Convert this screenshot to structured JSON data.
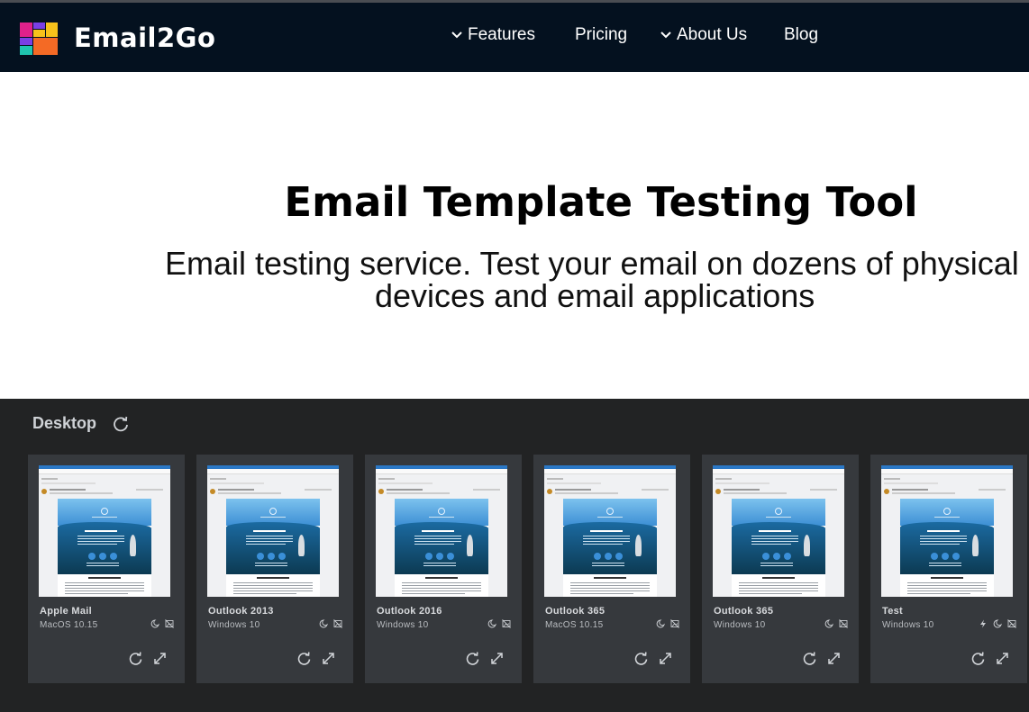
{
  "brand": {
    "name": "Email2Go"
  },
  "nav": [
    {
      "label": "Features",
      "has_dropdown": true
    },
    {
      "label": "Pricing",
      "has_dropdown": false
    },
    {
      "label": "About Us",
      "has_dropdown": true
    },
    {
      "label": "Blog",
      "has_dropdown": false
    }
  ],
  "hero": {
    "title": "Email Template Testing Tool",
    "subtitle_line1": "Email testing service. Test your email on dozens of physical",
    "subtitle_line2": "devices and email applications"
  },
  "section": {
    "title": "Desktop"
  },
  "cards": [
    {
      "client": "Apple Mail",
      "os": "MacOS 10.15",
      "icons": [
        "moon-icon",
        "no-image-icon"
      ]
    },
    {
      "client": "Outlook 2013",
      "os": "Windows 10",
      "icons": [
        "moon-icon",
        "no-image-icon"
      ]
    },
    {
      "client": "Outlook 2016",
      "os": "Windows 10",
      "icons": [
        "moon-icon",
        "no-image-icon"
      ]
    },
    {
      "client": "Outlook 365",
      "os": "MacOS 10.15",
      "icons": [
        "moon-icon",
        "no-image-icon"
      ]
    },
    {
      "client": "Outlook 365",
      "os": "Windows 10",
      "icons": [
        "moon-icon",
        "no-image-icon"
      ]
    },
    {
      "client": "Test",
      "os": "Windows 10",
      "icons": [
        "lightning-icon",
        "moon-icon",
        "no-image-icon"
      ]
    }
  ],
  "colors": {
    "navbar": "#04111f",
    "panel": "#222324",
    "card": "#36393d",
    "logo_magenta": "#e0218a",
    "logo_yellow": "#f7c21b",
    "logo_purple": "#7b3fe4",
    "logo_orange": "#f46a25",
    "logo_teal": "#20c5b0"
  }
}
